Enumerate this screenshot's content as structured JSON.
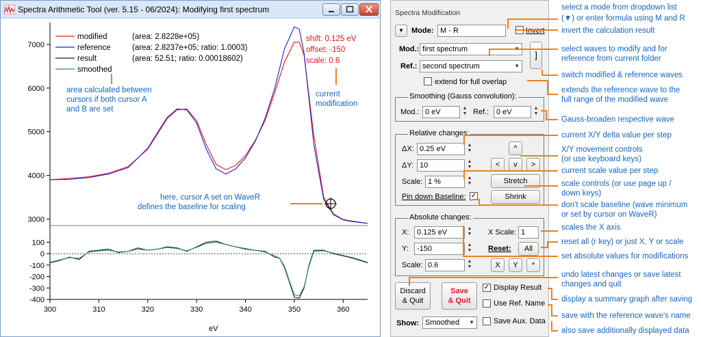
{
  "window": {
    "title": "Spectra Arithmetic Tool (ver. 5.15 - 06/2024): Modifying first spectrum"
  },
  "legend": {
    "modified_label": "modified",
    "modified_info": "(area: 2.8228e+05)",
    "reference_label": "reference",
    "reference_info": "(area: 2.8237e+05; ratio: 1.0003)",
    "result_label": "result",
    "result_info": "(area: 52.51; ratio: 0.00018602)",
    "smoothed_label": "smoothed"
  },
  "plot_notes": {
    "area_note": [
      "area calculated between",
      "cursors if both cursor A",
      "and B are set"
    ],
    "shift": "shift: 0.125 eV",
    "offset": "offset: -150",
    "scale": "scale: 0.6",
    "current_mod": [
      "current",
      "modification"
    ],
    "cursor_note": [
      "here, cursor A set on WaveR",
      "defines the baseline for scaling"
    ]
  },
  "chart_data": {
    "type": "line",
    "xlabel": "eV",
    "xlim": [
      300,
      365
    ],
    "x_ticks": [
      "300",
      "310",
      "320",
      "330",
      "340",
      "350",
      "360"
    ],
    "top": {
      "ylim": [
        2850,
        7500
      ],
      "y_ticks": [
        "3000",
        "4000",
        "5000",
        "6000",
        "7000"
      ],
      "series": [
        {
          "name": "modified",
          "color": "#e8141f",
          "x": [
            300,
            304,
            308,
            312,
            316,
            320,
            322,
            324,
            326,
            328,
            330,
            332,
            334,
            336,
            338,
            340,
            342,
            344,
            346,
            348,
            350,
            351,
            352,
            354,
            356,
            358,
            360,
            362,
            365
          ],
          "y": [
            3900,
            3930,
            3970,
            4050,
            4200,
            4600,
            4950,
            5300,
            5500,
            5520,
            5250,
            4700,
            4250,
            4130,
            4230,
            4450,
            4800,
            5250,
            5900,
            6600,
            7050,
            7050,
            6750,
            4900,
            3500,
            3120,
            2990,
            2950,
            2900
          ]
        },
        {
          "name": "reference",
          "color": "#1f1fc8",
          "x": [
            300,
            304,
            308,
            312,
            316,
            320,
            322,
            324,
            326,
            328,
            330,
            332,
            334,
            336,
            338,
            340,
            342,
            344,
            346,
            348,
            350,
            351,
            352,
            354,
            356,
            358,
            360,
            362,
            365
          ],
          "y": [
            3900,
            3910,
            3950,
            4030,
            4180,
            4620,
            4980,
            5330,
            5520,
            5500,
            5200,
            4600,
            4150,
            4030,
            4150,
            4400,
            4780,
            5300,
            6000,
            6900,
            7400,
            7350,
            6800,
            4700,
            3450,
            3100,
            2980,
            2940,
            2900
          ]
        }
      ]
    },
    "bottom": {
      "ylim": [
        -400,
        150
      ],
      "y_ticks": [
        "100",
        "0",
        "-100",
        "-200",
        "-300",
        "-400"
      ],
      "series": [
        {
          "name": "result",
          "color": "#222222",
          "x": [
            300,
            302,
            304,
            306,
            308,
            310,
            312,
            314,
            316,
            318,
            320,
            322,
            324,
            326,
            328,
            330,
            332,
            334,
            336,
            338,
            340,
            342,
            344,
            346,
            347,
            348,
            349,
            350,
            351,
            352,
            353,
            354,
            356,
            358,
            360,
            362,
            365
          ],
          "y": [
            -80,
            -60,
            -30,
            -50,
            20,
            30,
            40,
            10,
            20,
            50,
            30,
            40,
            60,
            50,
            20,
            60,
            100,
            110,
            80,
            60,
            40,
            30,
            20,
            -30,
            -40,
            -120,
            -250,
            -380,
            -390,
            -300,
            -100,
            30,
            30,
            0,
            -20,
            -40,
            -80
          ]
        },
        {
          "name": "smoothed",
          "color": "#2e8b57",
          "x": [
            300,
            302,
            304,
            306,
            308,
            310,
            312,
            314,
            316,
            318,
            320,
            322,
            324,
            326,
            328,
            330,
            332,
            334,
            336,
            338,
            340,
            342,
            344,
            346,
            347,
            348,
            349,
            350,
            351,
            352,
            353,
            354,
            356,
            358,
            360,
            362,
            365
          ],
          "y": [
            -75,
            -55,
            -35,
            -40,
            15,
            25,
            30,
            15,
            20,
            40,
            30,
            40,
            55,
            45,
            25,
            55,
            90,
            100,
            80,
            60,
            45,
            30,
            15,
            -20,
            -40,
            -110,
            -240,
            -360,
            -370,
            -290,
            -110,
            20,
            25,
            5,
            -15,
            -35,
            -75
          ]
        }
      ]
    }
  },
  "panel": {
    "title": "Spectra Modification",
    "mode_label": "Mode:",
    "mode_value": "M - R",
    "invert_label": "Invert",
    "mod_label": "Mod.:",
    "mod_value": "first spectrum",
    "ref_label": "Ref.:",
    "ref_value": "second spectrum",
    "swap_symbol": "]",
    "extend_label": "extend for full overlap",
    "smoothing_title": "Smoothing (Gauss convolution):",
    "smooth_mod_label": "Mod.:",
    "smooth_mod_value": "0 eV",
    "smooth_ref_label": "Ref.:",
    "smooth_ref_value": "0 eV",
    "relative_title": "Relative changes:",
    "dx_label": "ΔX:",
    "dx_value": "0.25 eV",
    "dy_label": "ΔY:",
    "dy_value": "10",
    "btn_up": "^",
    "btn_left": "<",
    "btn_down": "v",
    "btn_right": ">",
    "scale_label": "Scale:",
    "scale_value": "1 %",
    "stretch_label": "Stretch",
    "pin_label": "Pin down Baseline:",
    "shrink_label": "Shrink",
    "absolute_title": "Absolute changes:",
    "x_label": "X:",
    "x_value": "0.125 eV",
    "xscale_label": "X Scale:",
    "xscale_value": "1",
    "y_label": "Y:",
    "y_value": "-150",
    "reset_label": "Reset:",
    "all_label": "All",
    "abs_scale_label": "Scale:",
    "abs_scale_value": "0.6",
    "btn_x": "X",
    "btn_y": "Y",
    "btn_star": "*",
    "discard_label": "Discard\n& Quit",
    "save_label": "Save\n& Quit",
    "display_result_label": "Display Result",
    "use_ref_name_label": "Use Ref. Name",
    "show_label": "Show:",
    "show_value": "Smoothed",
    "save_aux_label": "Save Aux. Data"
  },
  "annotations": {
    "a1": "select a mode from dropdown list",
    "a2": "(▼) or enter formula using M and R",
    "a3": "invert the calculation result",
    "a4": "select waves to modify and for",
    "a5": "reference from current folder",
    "a6": "switch modified & reference waves",
    "a7": "extends the reference wave to the",
    "a8": "full range of the modified wave",
    "a9": "Gauss-broaden respective wave",
    "a10": "current X/Y delta value per step",
    "a11": "X/Y movement controls",
    "a12": "(or use keyboard keys)",
    "a13": "current scale value per step",
    "a14": "scale controls (or use page up /",
    "a15": "down keys)",
    "a16": "don't scale baseline (wave minimum",
    "a17": "or set by cursor on WaveR)",
    "a18": "scales the X axis",
    "a19": "reset all (r key) or just X, Y or scale",
    "a20": "set absolute values for modifications",
    "a21": "undo latest changes or save latest",
    "a22": "changes and quit",
    "a23": "display a summary graph after saving",
    "a24": "save with the reference wave's name",
    "a25": "also save additionally displayed data"
  },
  "colors": {
    "accent_orange": "#f07f1b",
    "annotation_blue": "#1565c0",
    "save_red": "#e8141f"
  }
}
